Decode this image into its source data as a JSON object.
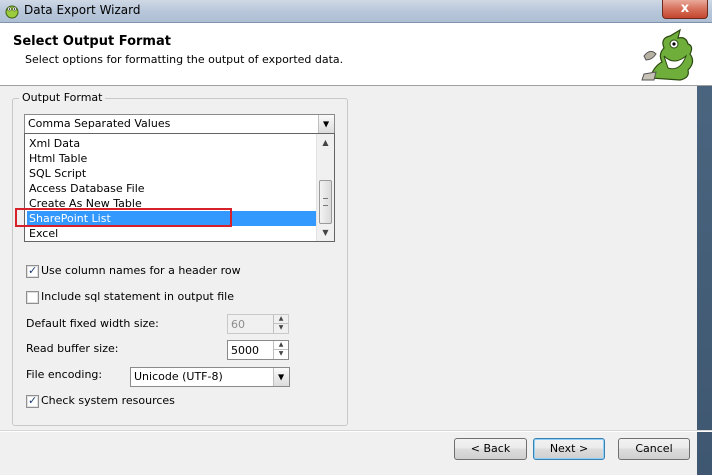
{
  "window": {
    "title": "Data Export Wizard",
    "close_label": "x"
  },
  "header": {
    "title": "Select Output Format",
    "subtitle": "Select options for formatting the output of exported data."
  },
  "output_format": {
    "group_label": "Output Format",
    "selected_value": "Comma Separated Values",
    "options": [
      "Xml Data",
      "Html Table",
      "SQL Script",
      "Access Database File",
      "Create As New Table",
      "SharePoint List",
      "Excel"
    ],
    "highlighted_option": "SharePoint List"
  },
  "options": {
    "use_column_names": {
      "label": "Use column names for a header row",
      "checked": true
    },
    "include_sql": {
      "label": "Include sql statement in output file",
      "checked": false
    },
    "check_system_resources": {
      "label": "Check system resources",
      "checked": true
    }
  },
  "fields": {
    "fixed_width": {
      "label": "Default fixed width size:",
      "value": "60",
      "enabled": false
    },
    "read_buffer": {
      "label": "Read buffer size:",
      "value": "5000",
      "enabled": true
    },
    "file_encoding": {
      "label": "File encoding:",
      "value": "Unicode (UTF-8)"
    }
  },
  "buttons": {
    "back": "< Back",
    "next": "Next >",
    "cancel": "Cancel"
  },
  "colors": {
    "selection": "#3399ff",
    "highlight_box": "#d6202a"
  }
}
